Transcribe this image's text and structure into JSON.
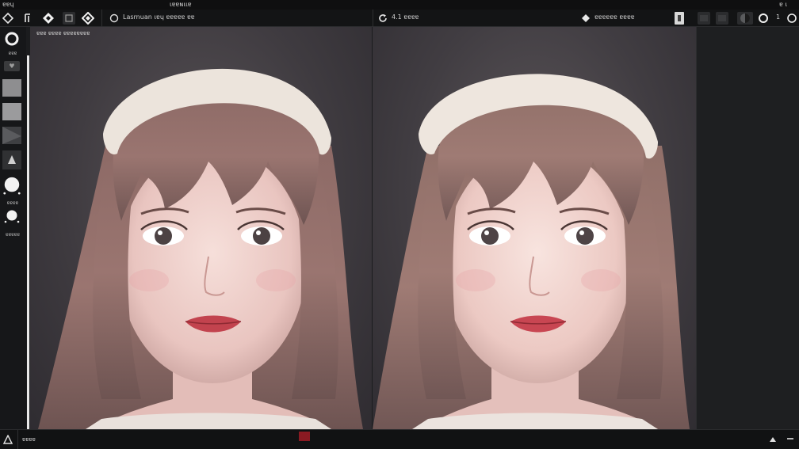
{
  "menubar": {
    "left_label": "ɐɐɥ",
    "center_label": "ɩɐɐɴɩɩɐ",
    "right_label": "ɐ ɩ"
  },
  "toolbar": {
    "document_label": "Lasrnuan ɩɐɥ ɐɐɐɐɐ ɐɐ",
    "version_label": "4.1 ɐɐɐɐ",
    "mode_label": "ɐɐɐɐɐɐ ɐɐɐɐ",
    "page_number": "1"
  },
  "left_panel": {
    "tool_label_1": "ɐɐɐ",
    "tool_label_2": "ɐɐɐɐ",
    "tool_label_3": "ɐɐɐɐɐ"
  },
  "canvas": {
    "caption": "ɐɐɐ ɐɐɐɐ ɐɐɐɐɐɐɐɐ"
  },
  "statusbar": {
    "left_label": "ɐɐɐɐ",
    "accent_color": "#8a1a22"
  },
  "icons": [
    "diamond-icon",
    "bracket-icon",
    "square-icon",
    "refresh-icon",
    "tag-icon",
    "circle-icon",
    "triangle-icon"
  ]
}
